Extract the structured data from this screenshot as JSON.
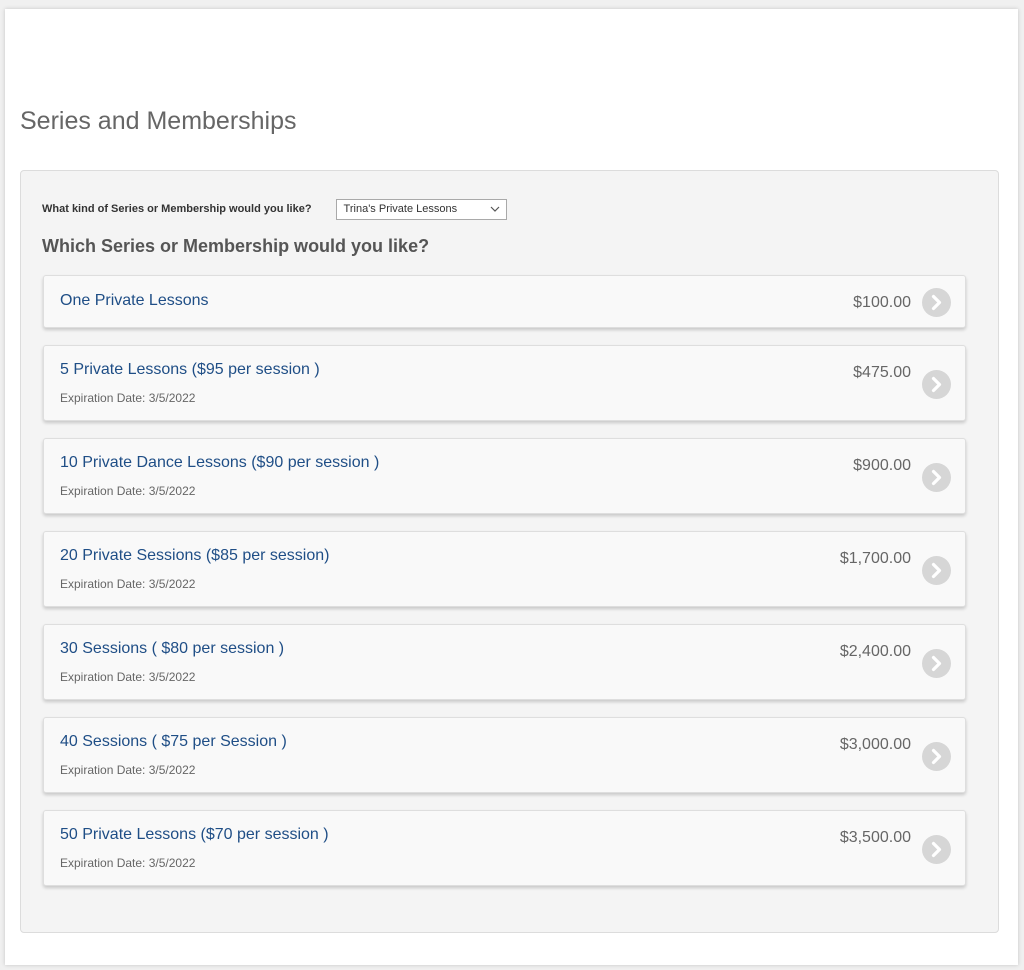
{
  "page": {
    "title": "Series and Memberships"
  },
  "filter": {
    "label": "What kind of Series or Membership would you like?",
    "selected": "Trina's Private Lessons"
  },
  "section": {
    "heading": "Which Series or Membership would you like?"
  },
  "items": [
    {
      "name": "One Private Lessons",
      "price": "$100.00",
      "expiration": ""
    },
    {
      "name": "5 Private Lessons ($95 per session )",
      "price": "$475.00",
      "expiration": "Expiration Date: 3/5/2022"
    },
    {
      "name": "10 Private Dance Lessons ($90 per session )",
      "price": "$900.00",
      "expiration": "Expiration Date: 3/5/2022"
    },
    {
      "name": "20 Private Sessions ($85 per session)",
      "price": "$1,700.00",
      "expiration": "Expiration Date: 3/5/2022"
    },
    {
      "name": "30 Sessions ( $80 per session )",
      "price": "$2,400.00",
      "expiration": "Expiration Date: 3/5/2022"
    },
    {
      "name": "40 Sessions ( $75 per Session )",
      "price": "$3,000.00",
      "expiration": "Expiration Date: 3/5/2022"
    },
    {
      "name": "50 Private Lessons ($70 per session )",
      "price": "$3,500.00",
      "expiration": "Expiration Date: 3/5/2022"
    }
  ],
  "icons": {
    "select_arrow": "chevron-down-icon",
    "item_arrow": "chevron-right-circle-icon"
  },
  "colors": {
    "link": "#1f4e86",
    "price": "#666666",
    "panel": "#f4f4f4",
    "arrow_button": "#d6d6d6"
  }
}
